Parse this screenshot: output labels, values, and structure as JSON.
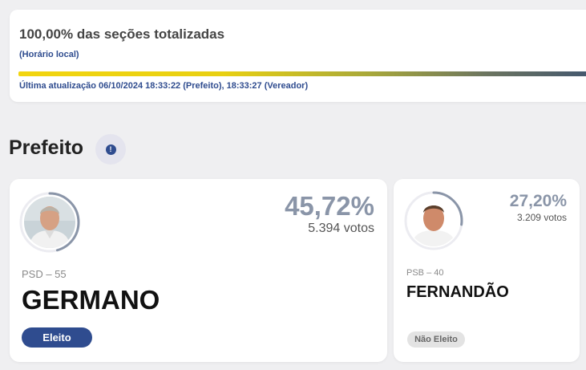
{
  "status": {
    "title": "100,00% das seções totalizadas",
    "subtitle": "(Horário local)",
    "progress_percent": 100,
    "last_update": "Última atualização 06/10/2024 18:33:22 (Prefeito), 18:33:27 (Vereador)"
  },
  "section": {
    "title": "Prefeito",
    "info_icon": "!"
  },
  "candidates": [
    {
      "party": "PSD – 55",
      "name": "GERMANO",
      "percent": "45,72%",
      "votes": "5.394 votos",
      "share": 0.4572,
      "status": "Eleito"
    },
    {
      "party": "PSB – 40",
      "name": "FERNANDÃO",
      "percent": "27,20%",
      "votes": "3.209 votos",
      "share": 0.272,
      "status": "Não Eleito"
    }
  ],
  "colors": {
    "accent": "#2f4c8f",
    "percent": "#8a95a8",
    "ring": "#8a95a8"
  }
}
